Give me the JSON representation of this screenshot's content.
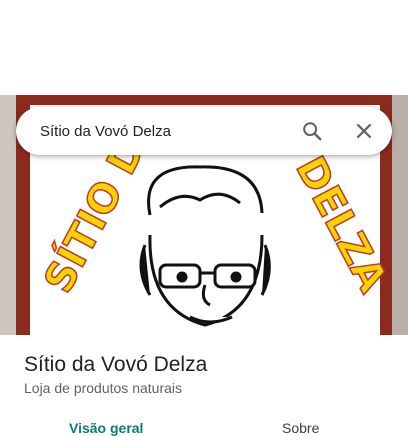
{
  "search": {
    "query": "Sítio da Vovó Delza",
    "search_icon": "search-icon",
    "clear_icon": "close-icon"
  },
  "hero": {
    "logo_text_left": "SÍTIO DA",
    "logo_text_right": "DELZA",
    "colors": {
      "frame": "#8b2b1d",
      "lettering": "#f5d400",
      "lettering_outline": "#c0392b"
    }
  },
  "place": {
    "name": "Sítio da Vovó Delza",
    "category": "Loja de produtos naturais"
  },
  "tabs": [
    {
      "label": "Visão geral",
      "active": true
    },
    {
      "label": "Sobre",
      "active": false
    }
  ],
  "colors": {
    "active_tab": "#0b7a75"
  }
}
